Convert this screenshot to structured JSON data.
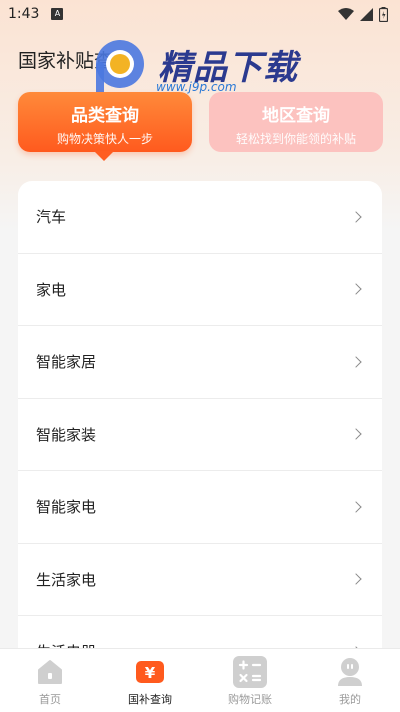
{
  "status_bar": {
    "time": "1:43",
    "notification_icon": "A"
  },
  "header": {
    "title": "国家补贴查询"
  },
  "watermark": {
    "brand_text": "精品下载",
    "url": "www.j9p.com"
  },
  "tabs": [
    {
      "title": "品类查询",
      "subtitle": "购物决策快人一步"
    },
    {
      "title": "地区查询",
      "subtitle": "轻松找到你能领的补贴"
    }
  ],
  "categories": [
    {
      "label": "汽车"
    },
    {
      "label": "家电"
    },
    {
      "label": "智能家居"
    },
    {
      "label": "智能家装"
    },
    {
      "label": "智能家电"
    },
    {
      "label": "生活家电"
    },
    {
      "label": "生活电器"
    }
  ],
  "bottom_nav": [
    {
      "label": "首页",
      "icon": "home-icon"
    },
    {
      "label": "国补查询",
      "icon": "yuan-ticket-icon"
    },
    {
      "label": "购物记账",
      "icon": "calculator-icon"
    },
    {
      "label": "我的",
      "icon": "profile-icon"
    }
  ],
  "colors": {
    "accent": "#ff5a1e",
    "secondary_tab": "#fcc2bf",
    "nav_inactive": "#c8c8c8"
  }
}
